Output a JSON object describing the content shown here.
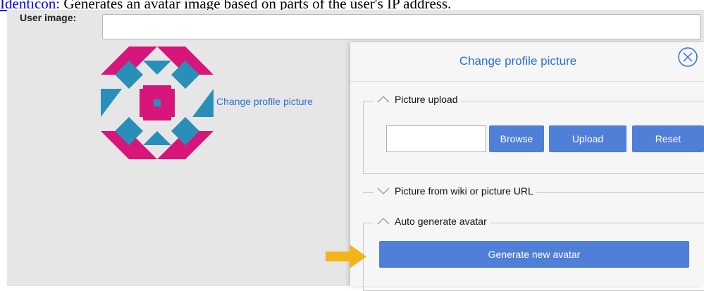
{
  "header": {
    "link_text": "Identicon:",
    "text": " Generates an avatar image based on parts of the user's IP address."
  },
  "form": {
    "user_image_label": "User image:",
    "user_image_value": ""
  },
  "profile": {
    "change_link": "Change profile picture"
  },
  "dialog": {
    "title": "Change profile picture",
    "sections": {
      "upload": {
        "label": "Picture upload",
        "browse": "Browse",
        "upload": "Upload",
        "reset": "Reset"
      },
      "wiki": {
        "label": "Picture from wiki or picture URL"
      },
      "auto": {
        "label": "Auto generate avatar",
        "generate": "Generate new avatar"
      }
    }
  },
  "colors": {
    "accent": "#4f7fd6",
    "link": "#2a6fd6",
    "avatar_magenta": "#d8157b",
    "avatar_teal": "#2a8fb8",
    "arrow": "#f2b418"
  }
}
